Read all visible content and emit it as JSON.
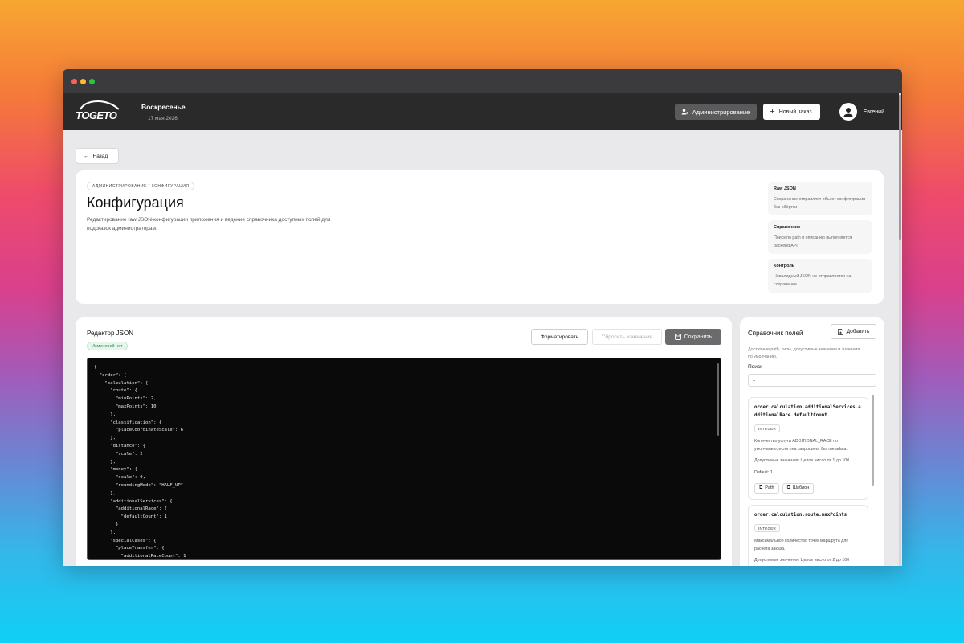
{
  "header": {
    "logo_text": "TOGETO",
    "day": "Воскресенье",
    "date": "17 мая 2026",
    "admin_label": "Администрирование",
    "new_order_label": "Новый заказ",
    "user_name": "Евгений"
  },
  "back_label": "Назад",
  "hero": {
    "breadcrumb": "Администрирование / Конфигурация",
    "title": "Конфигурация",
    "description": "Редактирование raw JSON-конфигурации приложения и ведение справочника доступных полей для подсказок администраторам.",
    "cards": [
      {
        "title": "Raw JSON",
        "text": "Сохранение отправляет объект конфигурации без обёртки"
      },
      {
        "title": "Справочник",
        "text": "Поиск по path и описанию выполняется backend API"
      },
      {
        "title": "Контроль",
        "text": "Невалидный JSON не отправляется на сохранение"
      }
    ]
  },
  "editor": {
    "title": "Редактор JSON",
    "status": "Изменений нет",
    "format_label": "Форматировать",
    "reset_label": "Сбросить изменения",
    "save_label": "Сохранить",
    "code": "{\n  \"order\": {\n    \"calculation\": {\n      \"route\": {\n        \"minPoints\": 2,\n        \"maxPoints\": 10\n      },\n      \"classification\": {\n        \"placeCoordinateScale\": 6\n      },\n      \"distance\": {\n        \"scale\": 2\n      },\n      \"money\": {\n        \"scale\": 0,\n        \"roundingMode\": \"HALF_UP\"\n      },\n      \"additionalServices\": {\n        \"additionalRace\": {\n          \"defaultCount\": 1\n        }\n      },\n      \"specialCases\": {\n        \"placeTransfer\": {\n          \"additionalRaceCount\": 1"
  },
  "reference": {
    "title": "Справочник полей",
    "add_label": "Добавить",
    "description": "Доступные path, типы, допустимые значения и значения по умолчанию.",
    "search_label": "Поиск",
    "search_value": "..",
    "fields": [
      {
        "path": "order.calculation.additionalServices.additionalRace.defaultCount",
        "type": "INTEGER",
        "description": "Количество услуги ADDITIONAL_RACE по умолчанию, если она запрошена без metadata.",
        "allowed": "Допустимые значения: Целое число от 1 до 100",
        "default": "Default:  1",
        "path_btn": "Path",
        "template_btn": "Шаблон"
      },
      {
        "path": "order.calculation.route.maxPoints",
        "type": "INTEGER",
        "description": "Максимальное количество точек маршрута для расчёта заказа.",
        "allowed": "Допустимые значения: Целое число от 2 до 100"
      }
    ]
  },
  "colors": {
    "appbar": "#2a2a2a",
    "status_green": "#2a8a4d",
    "save_button": "#6b6b6d"
  }
}
